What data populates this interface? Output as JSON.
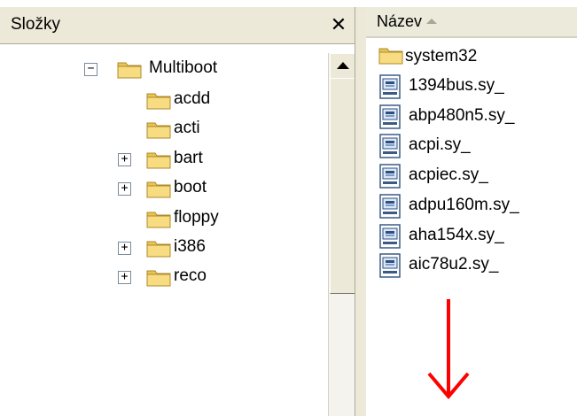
{
  "left_pane": {
    "title": "Složky",
    "close_glyph": "✕",
    "tree": [
      {
        "label": "Multiboot",
        "expander": "−",
        "level": 0
      },
      {
        "label": "acdd",
        "expander": null,
        "level": 1
      },
      {
        "label": "acti",
        "expander": null,
        "level": 1
      },
      {
        "label": "bart",
        "expander": "+",
        "level": 1
      },
      {
        "label": "boot",
        "expander": "+",
        "level": 1
      },
      {
        "label": "floppy",
        "expander": null,
        "level": 1
      },
      {
        "label": "i386",
        "expander": "+",
        "level": 1
      },
      {
        "label": "reco",
        "expander": "+",
        "level": 1
      }
    ]
  },
  "right_pane": {
    "column_header": "Název",
    "files": [
      {
        "name": "system32",
        "type": "folder"
      },
      {
        "name": "1394bus.sy_",
        "type": "file"
      },
      {
        "name": "abp480n5.sy_",
        "type": "file"
      },
      {
        "name": "acpi.sy_",
        "type": "file"
      },
      {
        "name": "acpiec.sy_",
        "type": "file"
      },
      {
        "name": "adpu160m.sy_",
        "type": "file"
      },
      {
        "name": "aha154x.sy_",
        "type": "file"
      },
      {
        "name": "aic78u2.sy_",
        "type": "file"
      }
    ]
  },
  "colors": {
    "annotation_arrow": "#ff0000",
    "folder_yellow": "#f5d76e",
    "chrome": "#ece9d8"
  },
  "icons": {
    "folder": "folder-icon",
    "file": "system-file-icon",
    "close": "close-icon",
    "scroll_up": "scroll-up-icon",
    "annotation": "red-down-arrow"
  }
}
